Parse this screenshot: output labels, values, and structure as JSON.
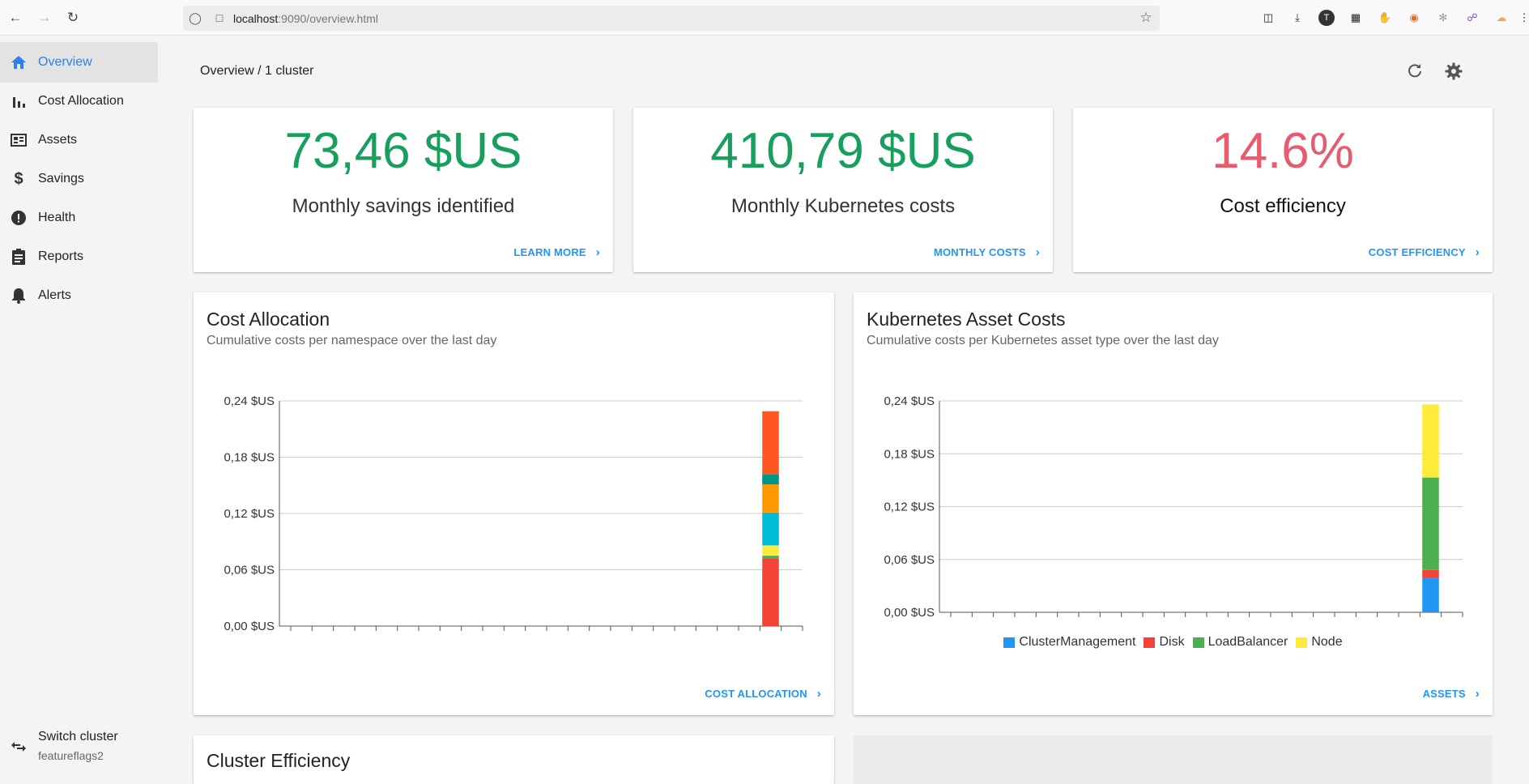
{
  "browser": {
    "url_host": "localhost",
    "url_rest": ":9090/overview.html"
  },
  "sidebar": {
    "items": [
      {
        "label": "Overview",
        "icon": "home-icon",
        "active": true
      },
      {
        "label": "Cost Allocation",
        "icon": "bar-chart-icon"
      },
      {
        "label": "Assets",
        "icon": "assets-icon"
      },
      {
        "label": "Savings",
        "icon": "dollar-icon"
      },
      {
        "label": "Health",
        "icon": "alert-circle-icon"
      },
      {
        "label": "Reports",
        "icon": "clipboard-icon"
      },
      {
        "label": "Alerts",
        "icon": "bell-icon"
      }
    ],
    "switch_cluster": {
      "title": "Switch cluster",
      "subtitle": "featureflags2"
    }
  },
  "header": {
    "breadcrumb": "Overview / 1 cluster"
  },
  "stats": [
    {
      "value": "73,46 $US",
      "label": "Monthly savings identified",
      "link": "LEARN MORE",
      "color": "#17a05d"
    },
    {
      "value": "410,79 $US",
      "label": "Monthly Kubernetes costs",
      "link": "MONTHLY COSTS",
      "color": "#17a05d"
    },
    {
      "value": "14.6%",
      "label": "Cost efficiency",
      "link": "COST EFFICIENCY",
      "color": "#e85a6e"
    }
  ],
  "cost_allocation": {
    "title": "Cost Allocation",
    "subtitle": "Cumulative costs per namespace over the last day",
    "link": "COST ALLOCATION"
  },
  "asset_costs": {
    "title": "Kubernetes Asset Costs",
    "subtitle": "Cumulative costs per Kubernetes asset type over the last day",
    "link": "ASSETS"
  },
  "cluster_efficiency": {
    "title": "Cluster Efficiency"
  },
  "chart_data": [
    {
      "type": "bar",
      "stacked": true,
      "ylim": [
        0,
        0.24
      ],
      "yticks": [
        "0,00 $US",
        "0,06 $US",
        "0,12 $US",
        "0,18 $US",
        "0,24 $US"
      ],
      "tick_values": [
        0,
        0.06,
        0.12,
        0.18,
        0.24
      ],
      "x_tick_count": 24,
      "bar_index": 22,
      "series": [
        {
          "value": 0.072,
          "color": "#f44336"
        },
        {
          "value": 0.003,
          "color": "#4caf50"
        },
        {
          "value": 0.011,
          "color": "#ffeb3b"
        },
        {
          "value": 0.035,
          "color": "#00bcd4"
        },
        {
          "value": 0.03,
          "color": "#ff9800"
        },
        {
          "value": 0.011,
          "color": "#009688"
        },
        {
          "value": 0.067,
          "color": "#ff5722"
        }
      ]
    },
    {
      "type": "bar",
      "stacked": true,
      "ylim": [
        0,
        0.24
      ],
      "yticks": [
        "0,00 $US",
        "0,06 $US",
        "0,12 $US",
        "0,18 $US",
        "0,24 $US"
      ],
      "tick_values": [
        0,
        0.06,
        0.12,
        0.18,
        0.24
      ],
      "x_tick_count": 24,
      "bar_index": 22,
      "series": [
        {
          "name": "ClusterManagement",
          "value": 0.039,
          "color": "#2196f3"
        },
        {
          "name": "Disk",
          "value": 0.009,
          "color": "#f44336"
        },
        {
          "name": "LoadBalancer",
          "value": 0.105,
          "color": "#4caf50"
        },
        {
          "name": "Node",
          "value": 0.083,
          "color": "#ffeb3b"
        }
      ]
    }
  ]
}
